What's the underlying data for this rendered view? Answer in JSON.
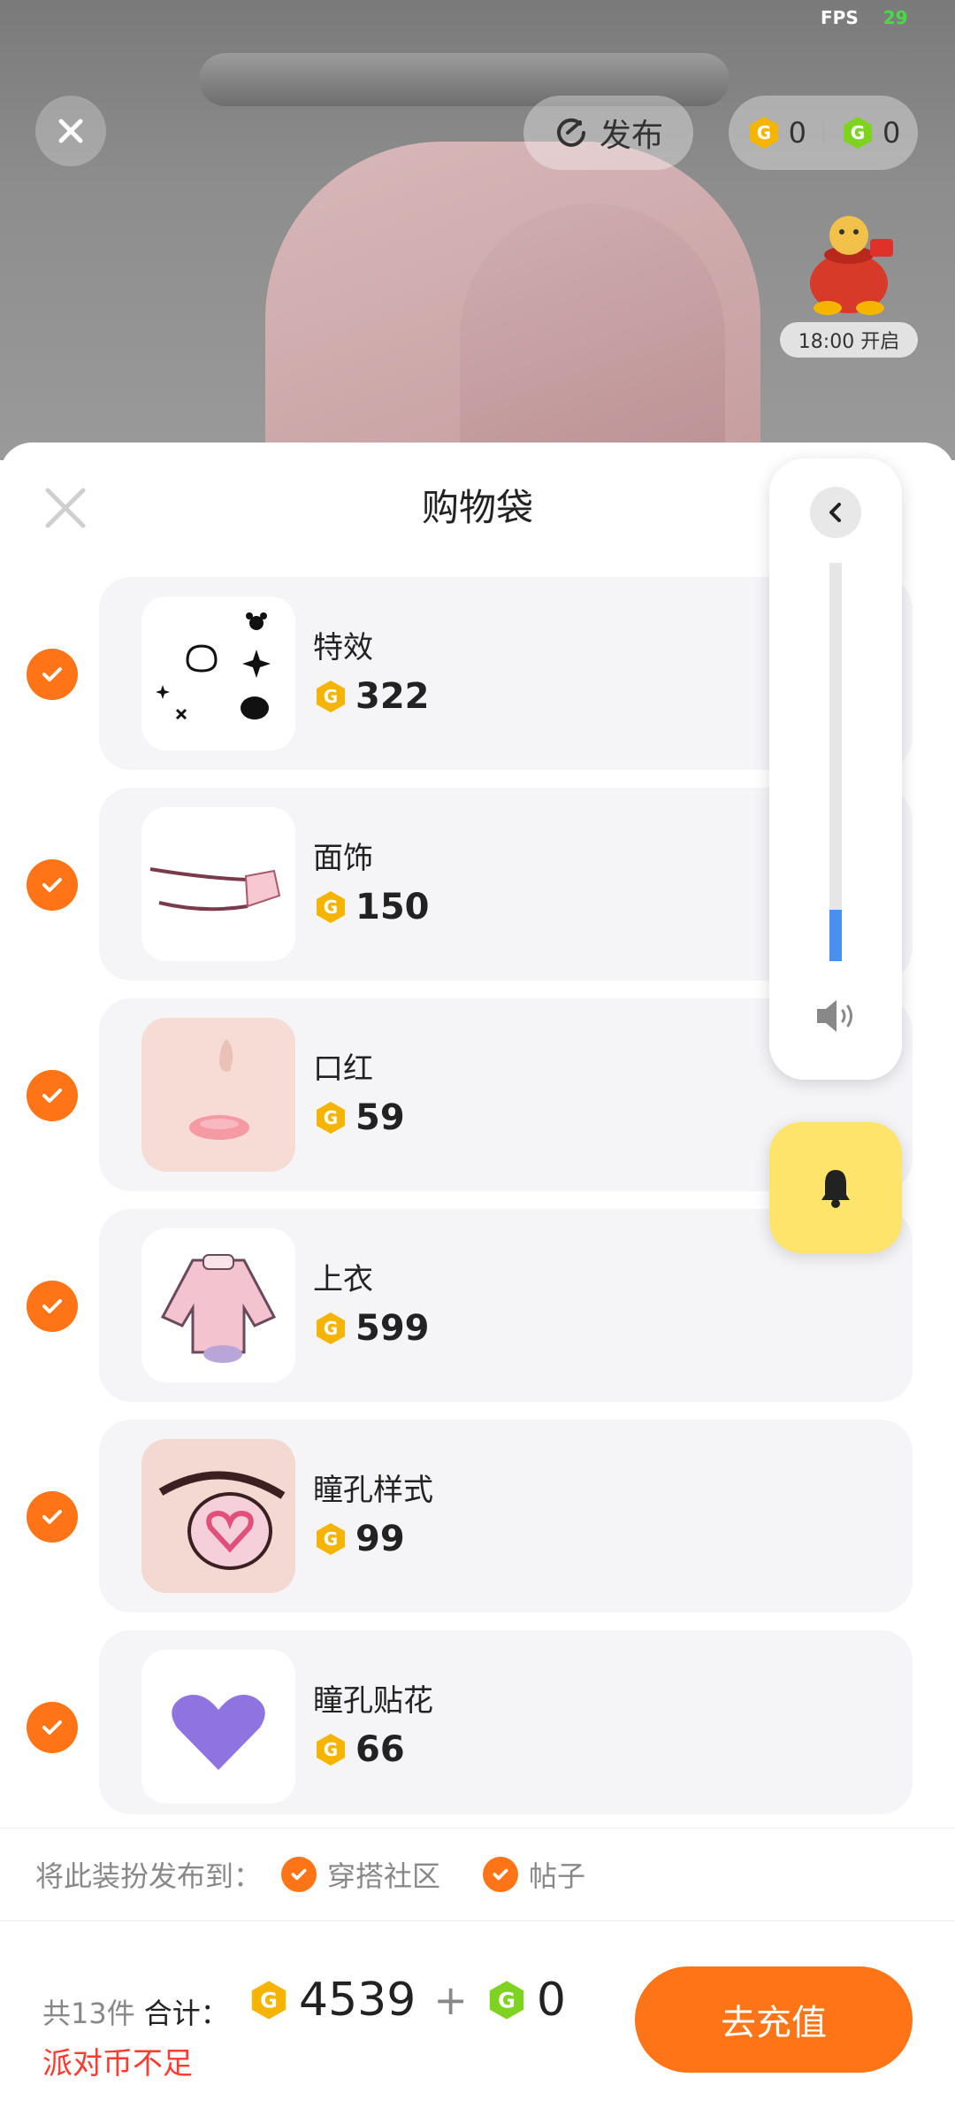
{
  "status": {
    "fps_label": "FPS",
    "fps_value": "29"
  },
  "top": {
    "publish_label": "发布",
    "coins_gold": "0",
    "coins_green": "0",
    "event_time": "18:00 开启"
  },
  "sheet": {
    "title": "购物袋",
    "items": [
      {
        "name": "特效",
        "price": "322",
        "checked": true
      },
      {
        "name": "面饰",
        "price": "150",
        "checked": true
      },
      {
        "name": "口红",
        "price": "59",
        "checked": true
      },
      {
        "name": "上衣",
        "price": "599",
        "checked": true
      },
      {
        "name": "瞳孔样式",
        "price": "99",
        "checked": true
      },
      {
        "name": "瞳孔贴花",
        "price": "66",
        "checked": true
      }
    ],
    "publish_to_label": "将此装扮发布到：",
    "publish_options": [
      "穿搭社区",
      "帖子"
    ],
    "count_label": "共13件",
    "total_label": "合计：",
    "total_gold": "4539",
    "plus": "+",
    "total_green": "0",
    "warning": "派对币不足",
    "recharge_button": "去充值"
  },
  "volume": {
    "level": 0.13
  },
  "colors": {
    "accent": "#ff7417",
    "gold": "#f5b400",
    "green": "#7ed321",
    "warn": "#ff3b30"
  }
}
